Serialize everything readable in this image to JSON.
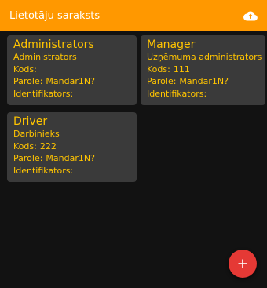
{
  "appbar": {
    "title": "Lietotāju saraksts",
    "cloud_icon": "cloud-upload-icon"
  },
  "labels": {
    "code": "Kods:",
    "password": "Parole:",
    "identifier": "Identifikators:"
  },
  "users": [
    {
      "title": "Administrators",
      "role": "Administrators",
      "code": "",
      "password": "Mandar1N?",
      "identifier": ""
    },
    {
      "title": "Manager",
      "role": "Uzņēmuma administrators",
      "code": "111",
      "password": "Mandar1N?",
      "identifier": ""
    },
    {
      "title": "Driver",
      "role": "Darbinieks",
      "code": "222",
      "password": "Mandar1N?",
      "identifier": ""
    }
  ],
  "fab": {
    "icon": "plus-icon",
    "label": "+"
  },
  "colors": {
    "appbar": "#FF9800",
    "background": "#121212",
    "card": "#3A3A3A",
    "card_text": "#FFC400",
    "fab": "#E53935"
  }
}
